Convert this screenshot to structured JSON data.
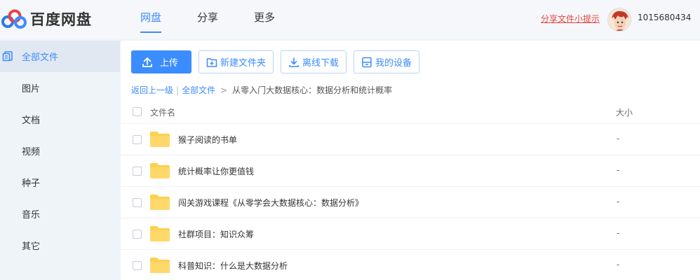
{
  "app": {
    "logo_text": "百度网盘"
  },
  "nav": [
    {
      "label": "网盘",
      "active": true
    },
    {
      "label": "分享",
      "active": false
    },
    {
      "label": "更多",
      "active": false
    }
  ],
  "header": {
    "share_tip": "分享文件小提示",
    "username": "1015680434"
  },
  "sidebar": {
    "items": [
      {
        "label": "全部文件",
        "active": true,
        "icon": "files-icon"
      },
      {
        "label": "图片",
        "active": false
      },
      {
        "label": "文档",
        "active": false
      },
      {
        "label": "视频",
        "active": false
      },
      {
        "label": "种子",
        "active": false
      },
      {
        "label": "音乐",
        "active": false
      },
      {
        "label": "其它",
        "active": false
      }
    ]
  },
  "toolbar": {
    "upload_label": "上传",
    "new_folder_label": "新建文件夹",
    "offline_download_label": "离线下载",
    "my_devices_label": "我的设备"
  },
  "breadcrumb": {
    "back_label": "返回上一级",
    "separator": "|",
    "root_label": "全部文件",
    "arrow": ">",
    "current": "从零入门大数据核心：数据分析和统计概率"
  },
  "table": {
    "columns": {
      "name": "文件名",
      "size": "大小"
    },
    "rows": [
      {
        "name": "猴子阅读的书单",
        "size": "-"
      },
      {
        "name": "统计概率让你更值钱",
        "size": "-"
      },
      {
        "name": "闯关游戏课程《从零学会大数据核心：数据分析》",
        "size": "-"
      },
      {
        "name": "社群项目：知识众筹",
        "size": "-"
      },
      {
        "name": "科普知识：什么是大数据分析",
        "size": "-"
      }
    ]
  },
  "colors": {
    "accent": "#3b8cff",
    "tip": "#e64340",
    "folder": "#ffd04d"
  }
}
